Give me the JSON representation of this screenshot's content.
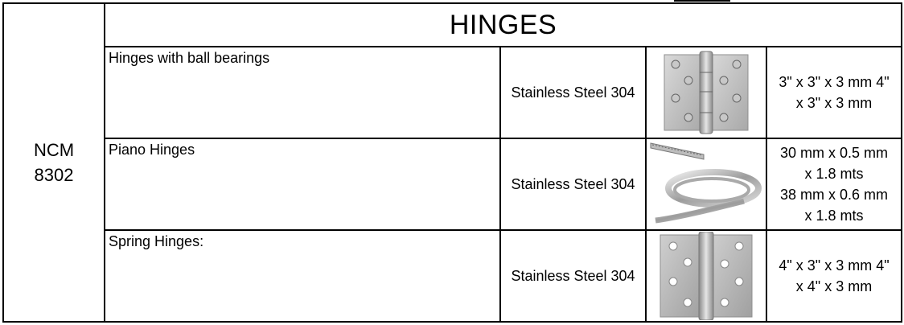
{
  "ncm_code_line1": "NCM",
  "ncm_code_line2": "8302",
  "title": "HINGES",
  "rows": [
    {
      "name": "Hinges with ball bearings",
      "material": "Stainless Steel 304",
      "image_icon": "ball-bearing-hinge-icon",
      "sizes": [
        "3\" x 3\" x 3 mm 4\"",
        "x 3\" x 3 mm"
      ]
    },
    {
      "name": "Piano Hinges",
      "material": "Stainless Steel 304",
      "image_icon": "piano-hinge-icon",
      "sizes": [
        "30 mm x 0.5 mm",
        "x 1.8 mts",
        "38 mm x 0.6 mm",
        "x 1.8 mts"
      ]
    },
    {
      "name": "Spring Hinges:",
      "material": "Stainless Steel 304",
      "image_icon": "spring-hinge-icon",
      "sizes": [
        "4\" x 3\" x 3 mm 4\"",
        "x 4\" x 3 mm"
      ]
    }
  ]
}
